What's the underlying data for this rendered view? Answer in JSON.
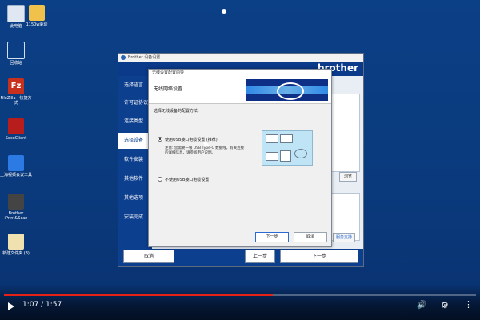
{
  "desktop": {
    "icons": [
      {
        "label": "此电脑"
      },
      {
        "label": "1150w驱动"
      },
      {
        "label": "回收站"
      },
      {
        "label": "FileZilla - 快捷方式"
      },
      {
        "label": "SecoClient"
      },
      {
        "label": "上海视频会议工具"
      },
      {
        "label": "Brother iPrint&Scan"
      },
      {
        "label": "新建文件夹 (3)"
      }
    ]
  },
  "installer": {
    "window_title": "Brother 设备设置",
    "brand": "brother",
    "nav": [
      {
        "label": "选择语言"
      },
      {
        "label": "许可证协议"
      },
      {
        "label": "连接类型"
      },
      {
        "label": "选择设备"
      },
      {
        "label": "软件安装"
      },
      {
        "label": "其他软件"
      },
      {
        "label": "其他选项"
      },
      {
        "label": "安装完成"
      }
    ],
    "browse_label": "浏览",
    "support_label": "服务支持",
    "bottom": {
      "cancel": "取消",
      "back": "上一步",
      "next": "下一步"
    }
  },
  "dialog": {
    "title": "无线设置配置向导",
    "header": "无线网络设置",
    "prompt": "选择无线设备的配置方法:",
    "options": [
      {
        "label": "使用USB接口电缆设置 (推荐)",
        "selected": true
      },
      {
        "label": "不使用USB接口电缆设置",
        "selected": false
      }
    ],
    "note": "注意: 您需要一根 USB Type-C 数据线。有关连接的详细信息，请参阅用户说明。",
    "next": "下一步",
    "cancel": "取消"
  },
  "player": {
    "time": "1:07 / 1:57",
    "progress": 0.57
  },
  "colors": {
    "desktop_bg": "#0b3f86",
    "installer_blue": "#0d3f8f",
    "progress_red": "#e62117"
  }
}
